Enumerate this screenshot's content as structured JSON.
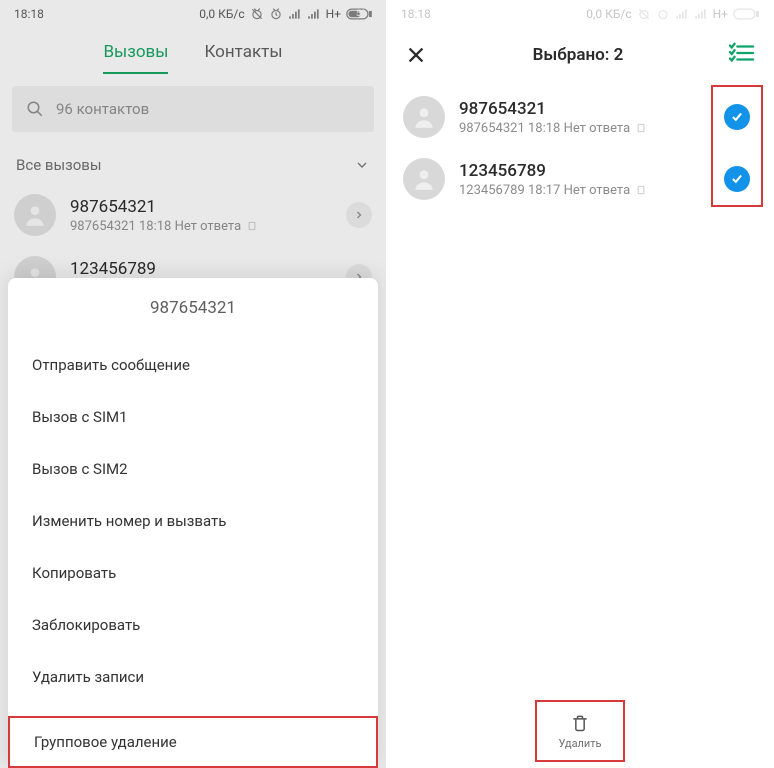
{
  "status": {
    "time": "18:18",
    "speed": "0,0 КБ/с",
    "net": "H+",
    "battery": "58"
  },
  "left": {
    "tabs": {
      "calls": "Вызовы",
      "contacts": "Контакты"
    },
    "search_placeholder": "96 контактов",
    "filter": "Все вызовы",
    "rows": [
      {
        "number": "987654321",
        "sub": "987654321  18:18 Нет ответа"
      },
      {
        "number": "123456789",
        "sub": "123456789  18:17 Нет ответа"
      }
    ],
    "sheet": {
      "header": "987654321",
      "items": [
        "Отправить сообщение",
        "Вызов с SIM1",
        "Вызов с SIM2",
        "Изменить номер и вызвать",
        "Копировать",
        "Заблокировать",
        "Удалить записи",
        "Групповое удаление"
      ]
    }
  },
  "right": {
    "title": "Выбрано: 2",
    "rows": [
      {
        "number": "987654321",
        "sub": "987654321  18:18 Нет ответа"
      },
      {
        "number": "123456789",
        "sub": "123456789  18:17 Нет ответа"
      }
    ],
    "delete_label": "Удалить"
  }
}
